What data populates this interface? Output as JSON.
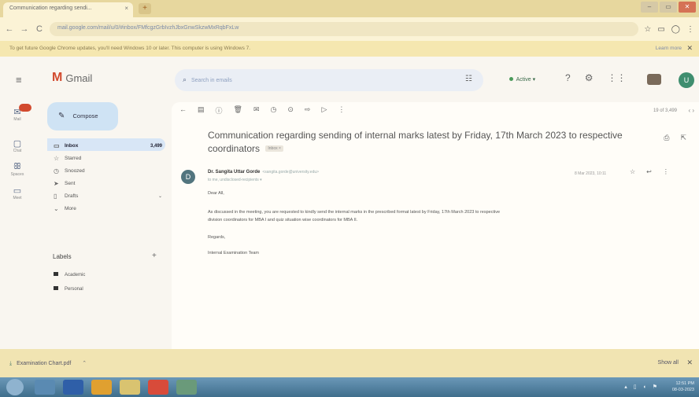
{
  "browser": {
    "tab_title": "Communication regarding sendi...",
    "tab_close": "×",
    "new_tab": "+",
    "url": "mail.google.com/mail/u/0/#inbox/FMfcgzGrbIvzhJbxGnwSkzwMxRqbFxLw",
    "nav": {
      "back": "←",
      "forward": "→",
      "reload": "C"
    },
    "right_icons": [
      "☆",
      "▭",
      "◯",
      "⋮"
    ],
    "window_controls": [
      "–",
      "▭",
      "✕"
    ]
  },
  "infobar": {
    "text": "To get future Google Chrome updates, you'll need Windows 10 or later. This computer is using Windows 7.",
    "learn_more": "Learn more",
    "close": "✕"
  },
  "gmail": {
    "logo_letter": "M",
    "logo_name": "Gmail",
    "hamburger": "≡",
    "search_placeholder": "Search in emails",
    "search_icon": "⌕",
    "tune_icon": "☷",
    "status": "Active",
    "header_icons": [
      "?",
      "⚙",
      "⋮⋮"
    ],
    "avatar_letter": "U",
    "rail": [
      {
        "icon": "✉",
        "label": "Mail"
      },
      {
        "icon": "▢",
        "label": "Chat"
      },
      {
        "icon": "ꕥ",
        "label": "Spaces"
      },
      {
        "icon": "▭",
        "label": "Meet"
      }
    ],
    "compose": "Compose",
    "compose_icon": "✎",
    "nav": [
      {
        "icon": "▭",
        "label": "Inbox",
        "count": "3,499"
      },
      {
        "icon": "☆",
        "label": "Starred",
        "count": ""
      },
      {
        "icon": "◷",
        "label": "Snoozed",
        "count": ""
      },
      {
        "icon": "➤",
        "label": "Sent",
        "count": ""
      },
      {
        "icon": "▯",
        "label": "Drafts",
        "count": ""
      },
      {
        "icon": "⌄",
        "label": "More",
        "count": ""
      }
    ],
    "labels_heading": "Labels",
    "labels_add": "+",
    "labels": [
      "Academic",
      "Personal"
    ],
    "toolbar_icons": [
      "←",
      "▤",
      "ⓘ",
      "🗑",
      "✉",
      "◷",
      "⊙",
      "⇨",
      "▷",
      "⋮"
    ],
    "pager": "19 of 3,499",
    "pager_nav": "‹ ›",
    "email": {
      "subject": "Communication regarding sending of internal marks latest by Friday, 17th March 2023 to respective coordinators",
      "inbox_chip": "Inbox ×",
      "subject_icons": [
        "⎙",
        "⇱"
      ],
      "sender_initial": "D",
      "sender_name": "Dr. Sangita Uttar Gorde",
      "sender_addr": "<sangita.gorde@university.edu>",
      "to": "to me, undisclosed-recipients ▾",
      "date": "8 Mar 2023, 10:11",
      "msg_icons": [
        "☆",
        "↩",
        "⋮"
      ],
      "greeting": "Dear All,",
      "body": "As discussed in the meeting, you are requested to kindly send the internal marks in the prescribed format latest by Friday, 17th March 2023 to respective",
      "body2": "division coordinators for MBA I and quiz situation wise coordinators for MBA II.",
      "regards": "Regards,",
      "signature": "Internal Examination Team"
    }
  },
  "downloadbar": {
    "filename": "Examination Chart.pdf",
    "file_icon": "⤓",
    "chevron": "⌃",
    "show_all": "Show all",
    "close": "✕"
  },
  "taskbar": {
    "apps": [
      {
        "name": "windows-explorer",
        "color": "#5a8ab2"
      },
      {
        "name": "word",
        "color": "#2f5fa8"
      },
      {
        "name": "media",
        "color": "#e0a030"
      },
      {
        "name": "folder",
        "color": "#d9c370"
      },
      {
        "name": "chrome",
        "color": "#d84b3a"
      },
      {
        "name": "photos",
        "color": "#6a9a7a"
      }
    ],
    "tray_icons": "▴ ▯ ◖ ⚑",
    "time": "12:51 PM",
    "date": "08-03-2023"
  }
}
